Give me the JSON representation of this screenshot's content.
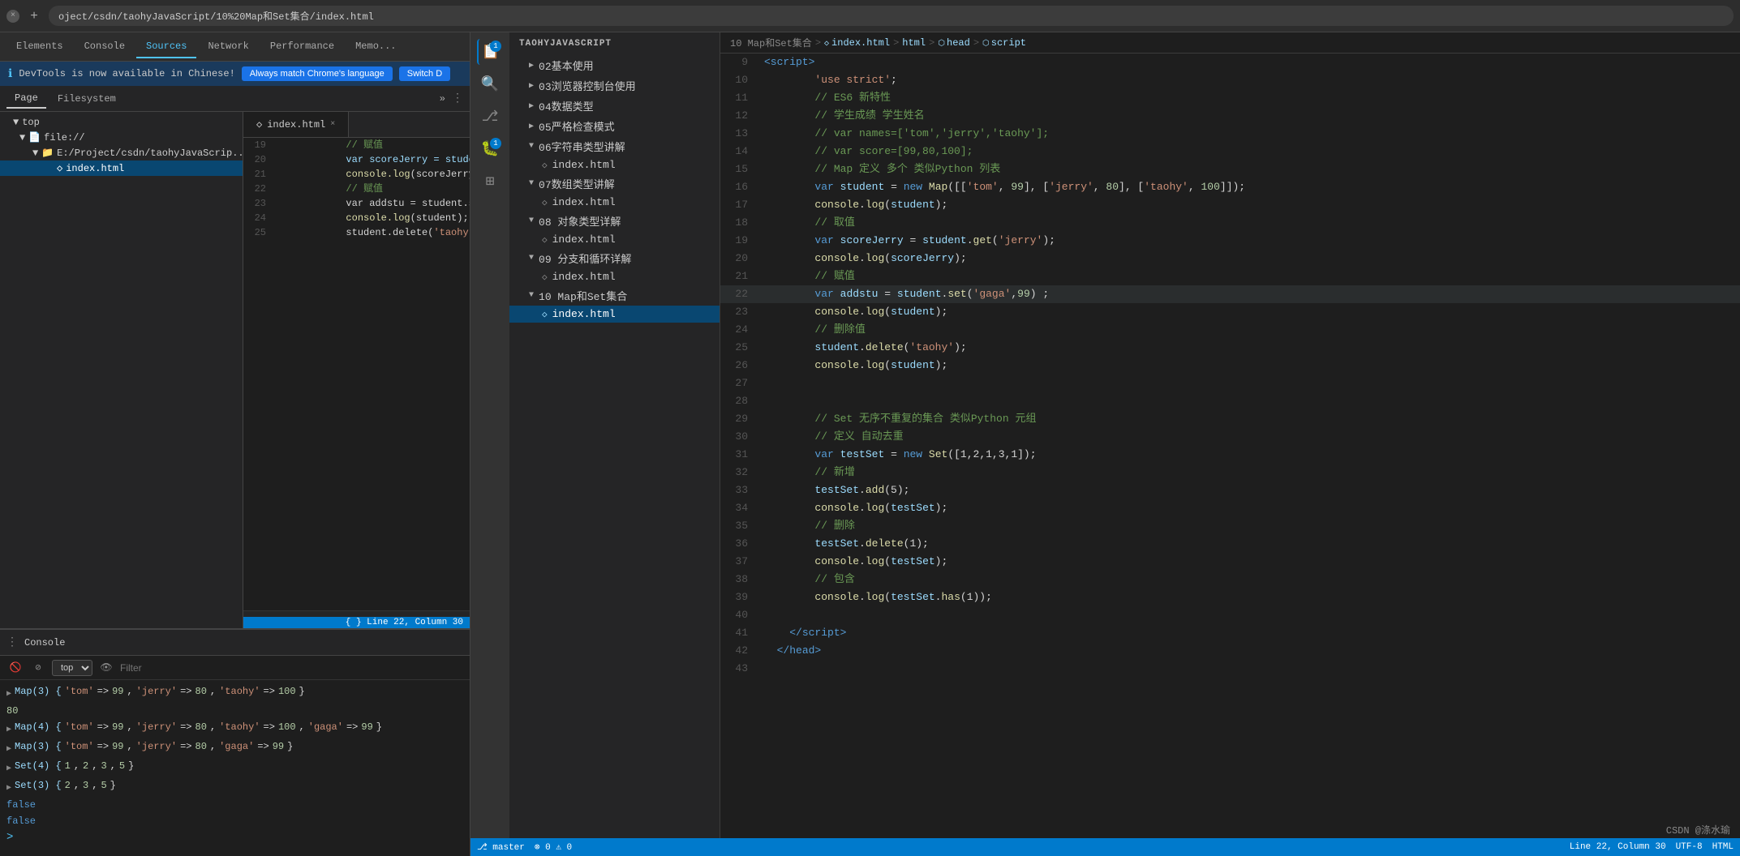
{
  "browser": {
    "address": "oject/csdn/taohyJavaScript/10%20Map和Set集合/index.html",
    "tab_close": "×",
    "tab_add": "+"
  },
  "devtools": {
    "info_text": "DevTools is now available in Chinese!",
    "btn_match": "Always match Chrome's language",
    "btn_switch": "Switch D",
    "tabs": [
      "Elements",
      "Console",
      "Sources",
      "Network",
      "Performance",
      "Memo..."
    ],
    "active_tab": "Sources"
  },
  "file_panel": {
    "tabs": [
      "Page",
      "Filesystem"
    ],
    "more": "»",
    "menu_icon": "⋮",
    "items": [
      {
        "label": "▼ top",
        "indent": 0
      },
      {
        "label": "▼ file://",
        "indent": 1
      },
      {
        "label": "▼ E:/Project/csdn/taohyJavaScrip...",
        "indent": 2
      },
      {
        "label": "index.html",
        "indent": 3,
        "selected": true
      }
    ]
  },
  "code_tab": {
    "name": "index.html",
    "close": "×",
    "status_line": "Line 22, Column 30",
    "lines": [
      {
        "num": 19,
        "content": "            // 赋值"
      },
      {
        "num": 20,
        "content": "            var scoreJerry = studen..."
      },
      {
        "num": 21,
        "content": "            console.log(scoreJerry)"
      },
      {
        "num": 22,
        "content": "            // 赋值"
      },
      {
        "num": 23,
        "content": "            var addstu = student.se..."
      },
      {
        "num": 24,
        "content": "            console.log(student);"
      },
      {
        "num": 25,
        "content": "            student.delete('taohy')"
      }
    ]
  },
  "console": {
    "label": "Console",
    "context": "top",
    "filter_placeholder": "Filter",
    "outputs": [
      "▶ Map(3) {'tom' => 99, 'jerry' => 80, 'taohy' => 100}",
      "80",
      "▶ Map(4) {'tom' => 99, 'jerry' => 80, 'taohy' => 100, 'gaga' => 99}",
      "▶ Map(3) {'tom' => 99, 'jerry' => 80, 'gaga' => 99}",
      "▶ Set(4) {1, 2, 3, 5}",
      "▶ Set(3) {2, 3, 5}",
      "false",
      "false"
    ]
  },
  "vscode": {
    "explorer_title": "TAOHYJAVASCRIPT",
    "breadcrumb": [
      "10 Map和Set集合",
      "index.html",
      "html",
      "head",
      "script"
    ],
    "items": [
      {
        "label": "▶ 02基本使用",
        "indent": 1
      },
      {
        "label": "▶ 03浏览器控制台使用",
        "indent": 1
      },
      {
        "label": "▶ 04数据类型",
        "indent": 1
      },
      {
        "label": "▶ 05严格检查模式",
        "indent": 1
      },
      {
        "label": "▶ 06字符串类型讲解",
        "indent": 1
      },
      {
        "label": "◇ index.html",
        "indent": 2
      },
      {
        "label": "▶ 07数组类型讲解",
        "indent": 1
      },
      {
        "label": "◇ index.html",
        "indent": 2
      },
      {
        "label": "▶ 08 对象类型详解",
        "indent": 1
      },
      {
        "label": "◇ index.html",
        "indent": 2
      },
      {
        "label": "▶ 09 分支和循环详解",
        "indent": 1
      },
      {
        "label": "◇ index.html",
        "indent": 2
      },
      {
        "label": "▼ 10 Map和Set集合",
        "indent": 1
      },
      {
        "label": "◇ index.html",
        "indent": 2,
        "selected": true
      }
    ]
  },
  "editor": {
    "lines": [
      {
        "num": 9,
        "html": "<span class='tag'>&lt;script&gt;</span>"
      },
      {
        "num": 10,
        "html": "    <span class='str'>'use strict'</span><span class='white'>;</span>"
      },
      {
        "num": 11,
        "html": "    <span class='cmt'>// ES6 新特性</span>"
      },
      {
        "num": 12,
        "html": "    <span class='cmt'>// 学生成绩 学生姓名</span>"
      },
      {
        "num": 13,
        "html": "    <span class='cmt'>// var names=['tom','jerry','taohy'];</span>"
      },
      {
        "num": 14,
        "html": "    <span class='cmt'>// var score=[99,80,100];</span>"
      },
      {
        "num": 15,
        "html": "    <span class='cmt'>// Map 定义 多个 类似Python 列表</span>"
      },
      {
        "num": 16,
        "html": "    <span class='kw'>var</span> <span class='cyan'>student</span> <span class='op'>=</span> <span class='kw'>new</span> <span class='fn'>Map</span><span class='white'>([[</span><span class='str'>'tom'</span><span class='white'>,</span> <span class='num'>99</span><span class='white'>], [</span><span class='str'>'jerry'</span><span class='white'>,</span> <span class='num'>80</span><span class='white'>], [</span><span class='str'>'taohy'</span><span class='white'>,</span> <span class='num'>100</span><span class='white'>]]);</span>"
      },
      {
        "num": 17,
        "html": "    <span class='fn'>console</span><span class='white'>.</span><span class='fn'>log</span><span class='white'>(</span><span class='cyan'>student</span><span class='white'>);</span>"
      },
      {
        "num": 18,
        "html": "    <span class='cmt'>// 取值</span>"
      },
      {
        "num": 19,
        "html": "    <span class='kw'>var</span> <span class='cyan'>scoreJerry</span> <span class='op'>=</span> <span class='cyan'>student</span><span class='white'>.</span><span class='fn'>get</span><span class='white'>(</span><span class='str'>'jerry'</span><span class='white'>);</span>"
      },
      {
        "num": 20,
        "html": "    <span class='fn'>console</span><span class='white'>.</span><span class='fn'>log</span><span class='white'>(</span><span class='cyan'>scoreJerry</span><span class='white'>);</span>"
      },
      {
        "num": 21,
        "html": "    <span class='cmt'>// 赋值</span>"
      },
      {
        "num": 22,
        "html": "    <span class='kw'>var</span> <span class='cyan'>addstu</span> <span class='op'>=</span> <span class='cyan'>student</span><span class='white'>.</span><span class='fn'>set</span><span class='white'>(</span><span class='str'>'gaga'</span><span class='white'>,</span><span class='num'>99</span><span class='white'>) ;</span>"
      },
      {
        "num": 23,
        "html": "    <span class='fn'>console</span><span class='white'>.</span><span class='fn'>log</span><span class='white'>(</span><span class='cyan'>student</span><span class='white'>);</span>"
      },
      {
        "num": 24,
        "html": "    <span class='cmt'>// 删除值</span>"
      },
      {
        "num": 25,
        "html": "    <span class='cyan'>student</span><span class='white'>.</span><span class='fn'>delete</span><span class='white'>(</span><span class='str'>'taohy'</span><span class='white'>);</span>"
      },
      {
        "num": 26,
        "html": "    <span class='fn'>console</span><span class='white'>.</span><span class='fn'>log</span><span class='white'>(</span><span class='cyan'>student</span><span class='white'>);</span>"
      },
      {
        "num": 27,
        "html": ""
      },
      {
        "num": 28,
        "html": ""
      },
      {
        "num": 29,
        "html": "    <span class='cmt'>// Set 无序不重复的集合 类似Python 元组</span>"
      },
      {
        "num": 30,
        "html": "    <span class='cmt'>// 定义 自动去重</span>"
      },
      {
        "num": 31,
        "html": "    <span class='kw'>var</span> <span class='cyan'>testSet</span> <span class='op'>=</span> <span class='kw'>new</span> <span class='fn'>Set</span><span class='white'>([1,2,1,3,1]);</span>"
      },
      {
        "num": 32,
        "html": "    <span class='cmt'>// 新增</span>"
      },
      {
        "num": 33,
        "html": "    <span class='cyan'>testSet</span><span class='white'>.</span><span class='fn'>add</span><span class='white'>(5);</span>"
      },
      {
        "num": 34,
        "html": "    <span class='fn'>console</span><span class='white'>.</span><span class='fn'>log</span><span class='white'>(</span><span class='cyan'>testSet</span><span class='white'>);</span>"
      },
      {
        "num": 35,
        "html": "    <span class='cmt'>// 删除</span>"
      },
      {
        "num": 36,
        "html": "    <span class='cyan'>testSet</span><span class='white'>.</span><span class='fn'>delete</span><span class='white'>(1);</span>"
      },
      {
        "num": 37,
        "html": "    <span class='fn'>console</span><span class='white'>.</span><span class='fn'>log</span><span class='white'>(</span><span class='cyan'>testSet</span><span class='white'>);</span>"
      },
      {
        "num": 38,
        "html": "    <span class='cmt'>// 包含</span>"
      },
      {
        "num": 39,
        "html": "    <span class='fn'>console</span><span class='white'>.</span><span class='fn'>log</span><span class='white'>(</span><span class='cyan'>testSet</span><span class='white'>.</span><span class='fn'>has</span><span class='white'>(1));</span>"
      },
      {
        "num": 40,
        "html": ""
      },
      {
        "num": 41,
        "html": "  <span class='tag'>&lt;/script&gt;</span>"
      },
      {
        "num": 42,
        "html": "  <span class='tag'>&lt;/head&gt;</span>"
      },
      {
        "num": 43,
        "html": ""
      }
    ]
  },
  "status": {
    "line_col": "Line 22, Column 30",
    "watermark": "CSDN @涤水瑜"
  }
}
